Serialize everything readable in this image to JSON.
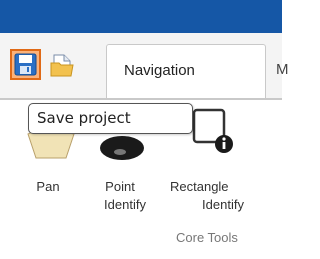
{
  "window": {
    "titlebar_color": "#1557a6"
  },
  "quick_access": {
    "save": {
      "icon": "save-icon",
      "highlight_color": "#fbb27a",
      "border_color": "#e06a16"
    },
    "open": {
      "icon": "folder-icon"
    }
  },
  "tabs": [
    {
      "label": "Navigation",
      "active": true
    },
    {
      "label": "M",
      "active": false
    }
  ],
  "tooltip": {
    "text": "Save project"
  },
  "tools": {
    "pan": {
      "label": "Pan",
      "icon": "pan-icon"
    },
    "point_identify": {
      "label_line1": "Point",
      "label_line2": "Identify",
      "icon": "point-identify-icon"
    },
    "rectangle_identify": {
      "label_line1": "Rectangle",
      "label_line2": "Identify",
      "icon": "rectangle-identify-icon"
    }
  },
  "group": {
    "label": "Core Tools"
  }
}
